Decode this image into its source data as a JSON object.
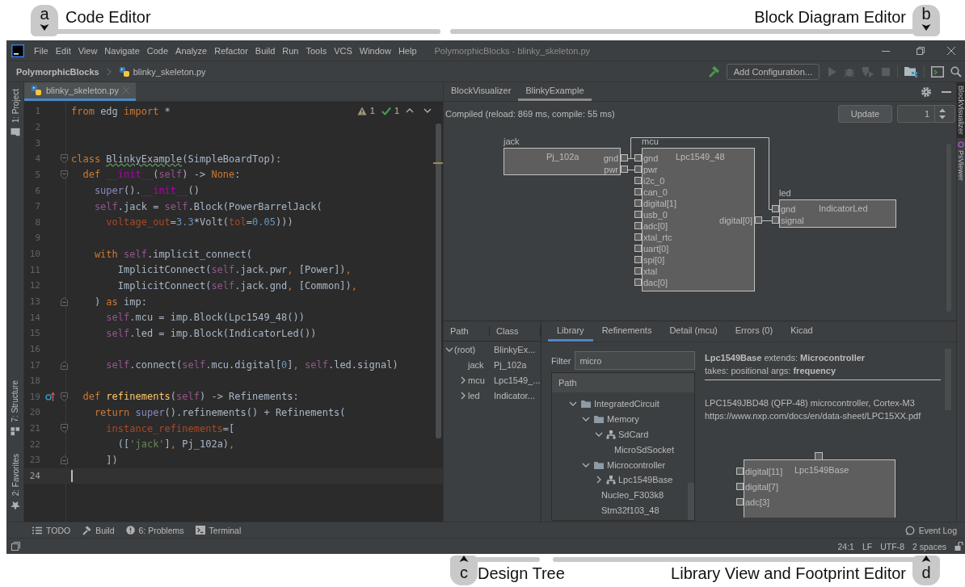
{
  "annotations_top": [
    {
      "letter": "a",
      "label": "Code Editor"
    },
    {
      "letter": "b",
      "label": "Block Diagram Editor"
    }
  ],
  "window": {
    "menu": [
      "File",
      "Edit",
      "View",
      "Navigate",
      "Code",
      "Analyze",
      "Refactor",
      "Build",
      "Run",
      "Tools",
      "VCS",
      "Window",
      "Help"
    ],
    "title": "PolymorphicBlocks - blinky_skeleton.py"
  },
  "navigation_bar": {
    "project": "PolymorphicBlocks",
    "file": "blinky_skeleton.py",
    "run_configuration": "Add Configuration..."
  },
  "left_tool_strip": [
    {
      "label": "1: Project",
      "kind": "project"
    },
    {
      "label": "7: Structure",
      "kind": "structure"
    },
    {
      "label": "2: Favorites",
      "kind": "favorites"
    }
  ],
  "editor": {
    "tabs": [
      {
        "label": "blinky_skeleton.py",
        "selected": true
      }
    ],
    "inspections": {
      "warnings": "1",
      "passed": "1"
    },
    "lines": [
      {
        "number": "1",
        "kind": "line",
        "caret": false,
        "tokens": [
          {
            "kind": "keyword",
            "text": "from"
          },
          {
            "kind": "plain",
            "text": " edg "
          },
          {
            "kind": "keyword",
            "text": "import"
          },
          {
            "kind": "plain",
            "text": " *"
          }
        ]
      },
      {
        "number": "2",
        "kind": "line",
        "caret": false
      },
      {
        "number": "3",
        "kind": "line",
        "caret": false
      },
      {
        "number": "4",
        "kind": "fold-start",
        "caret": false,
        "tokens": [
          {
            "kind": "keyword",
            "text": "class "
          },
          {
            "kind": "typo",
            "text": "BlinkyExample"
          },
          {
            "kind": "plain",
            "text": "(SimpleBoardTop):"
          }
        ]
      },
      {
        "number": "5",
        "kind": "fold-start",
        "caret": false,
        "tokens": [
          {
            "kind": "keyword",
            "text": "  def "
          },
          {
            "kind": "magic",
            "text": "__init__"
          },
          {
            "kind": "plain",
            "text": "("
          },
          {
            "kind": "self",
            "text": "self"
          },
          {
            "kind": "plain",
            "text": ") -> "
          },
          {
            "kind": "keyword",
            "text": "None"
          },
          {
            "kind": "plain",
            "text": ":"
          }
        ]
      },
      {
        "number": "6",
        "kind": "line",
        "caret": false,
        "tokens": [
          {
            "kind": "builtin",
            "text": "    super"
          },
          {
            "kind": "plain",
            "text": "()."
          },
          {
            "kind": "magic",
            "text": "__init__"
          },
          {
            "kind": "plain",
            "text": "()"
          }
        ]
      },
      {
        "number": "7",
        "kind": "line",
        "caret": false,
        "tokens": [
          {
            "kind": "self",
            "text": "    self"
          },
          {
            "kind": "plain",
            "text": ".jack = "
          },
          {
            "kind": "self",
            "text": "self"
          },
          {
            "kind": "plain",
            "text": ".Block(PowerBarrelJack("
          }
        ]
      },
      {
        "number": "8",
        "kind": "line",
        "caret": false,
        "tokens": [
          {
            "kind": "param",
            "text": "      voltage_out"
          },
          {
            "kind": "plain",
            "text": "="
          },
          {
            "kind": "number",
            "text": "3.3"
          },
          {
            "kind": "plain",
            "text": "*Volt("
          },
          {
            "kind": "param",
            "text": "tol"
          },
          {
            "kind": "plain",
            "text": "="
          },
          {
            "kind": "number",
            "text": "0.05"
          },
          {
            "kind": "plain",
            "text": ")))"
          }
        ]
      },
      {
        "number": "9",
        "kind": "line",
        "caret": false
      },
      {
        "number": "10",
        "kind": "line",
        "caret": false,
        "tokens": [
          {
            "kind": "keyword",
            "text": "    with "
          },
          {
            "kind": "self",
            "text": "self"
          },
          {
            "kind": "plain",
            "text": ".implicit_connect("
          }
        ]
      },
      {
        "number": "11",
        "kind": "line",
        "caret": false,
        "tokens": [
          {
            "kind": "plain",
            "text": "        ImplicitConnect("
          },
          {
            "kind": "self",
            "text": "self"
          },
          {
            "kind": "plain",
            "text": ".jack.pwr"
          },
          {
            "kind": "keyword",
            "text": ", "
          },
          {
            "kind": "plain",
            "text": "[Power])"
          },
          {
            "kind": "keyword",
            "text": ","
          }
        ]
      },
      {
        "number": "12",
        "kind": "line",
        "caret": false,
        "tokens": [
          {
            "kind": "plain",
            "text": "        ImplicitConnect("
          },
          {
            "kind": "self",
            "text": "self"
          },
          {
            "kind": "plain",
            "text": ".jack.gnd"
          },
          {
            "kind": "keyword",
            "text": ", "
          },
          {
            "kind": "plain",
            "text": "[Common])"
          },
          {
            "kind": "keyword",
            "text": ","
          }
        ]
      },
      {
        "number": "13",
        "kind": "fold-end",
        "caret": false,
        "tokens": [
          {
            "kind": "plain",
            "text": "    ) "
          },
          {
            "kind": "keyword",
            "text": "as"
          },
          {
            "kind": "plain",
            "text": " imp:"
          }
        ]
      },
      {
        "number": "14",
        "kind": "line",
        "caret": false,
        "tokens": [
          {
            "kind": "self",
            "text": "      self"
          },
          {
            "kind": "plain",
            "text": ".mcu = imp.Block(Lpc1549_48())"
          }
        ]
      },
      {
        "number": "15",
        "kind": "line",
        "caret": false,
        "tokens": [
          {
            "kind": "self",
            "text": "      self"
          },
          {
            "kind": "plain",
            "text": ".led = imp.Block(IndicatorLed())"
          }
        ]
      },
      {
        "number": "16",
        "kind": "line",
        "caret": false
      },
      {
        "number": "17",
        "kind": "fold-end",
        "caret": false,
        "tokens": [
          {
            "kind": "self",
            "text": "      self"
          },
          {
            "kind": "plain",
            "text": ".connect("
          },
          {
            "kind": "self",
            "text": "self"
          },
          {
            "kind": "plain",
            "text": ".mcu.digital["
          },
          {
            "kind": "number",
            "text": "0"
          },
          {
            "kind": "plain",
            "text": "]"
          },
          {
            "kind": "keyword",
            "text": ", "
          },
          {
            "kind": "self",
            "text": "self"
          },
          {
            "kind": "plain",
            "text": ".led.signal)"
          }
        ]
      },
      {
        "number": "18",
        "kind": "line",
        "caret": false
      },
      {
        "number": "19",
        "kind": "override",
        "caret": false,
        "tokens": [
          {
            "kind": "keyword",
            "text": "  def "
          },
          {
            "kind": "function",
            "text": "refinements"
          },
          {
            "kind": "plain",
            "text": "("
          },
          {
            "kind": "self",
            "text": "self"
          },
          {
            "kind": "plain",
            "text": ") -> Refinements:"
          }
        ]
      },
      {
        "number": "20",
        "kind": "line",
        "caret": false,
        "tokens": [
          {
            "kind": "keyword",
            "text": "    return "
          },
          {
            "kind": "builtin",
            "text": "super"
          },
          {
            "kind": "plain",
            "text": "().refinements() + Refinements("
          }
        ]
      },
      {
        "number": "21",
        "kind": "fold-start",
        "caret": false,
        "tokens": [
          {
            "kind": "param",
            "text": "      instance_refinements"
          },
          {
            "kind": "plain",
            "text": "=["
          }
        ]
      },
      {
        "number": "22",
        "kind": "line",
        "caret": false,
        "tokens": [
          {
            "kind": "plain",
            "text": "        (["
          },
          {
            "kind": "string",
            "text": "'jack'"
          },
          {
            "kind": "plain",
            "text": "]"
          },
          {
            "kind": "keyword",
            "text": ", "
          },
          {
            "kind": "plain",
            "text": "Pj_102a)"
          },
          {
            "kind": "keyword",
            "text": ","
          }
        ]
      },
      {
        "number": "23",
        "kind": "fold-end",
        "caret": false,
        "tokens": [
          {
            "kind": "plain",
            "text": "      ])"
          }
        ]
      },
      {
        "number": "24",
        "kind": "line",
        "caret": true
      }
    ]
  },
  "visualizer": {
    "tabs": [
      {
        "label": "BlockVisualizer",
        "selected": false
      },
      {
        "label": "BlinkyExample",
        "selected": true
      }
    ],
    "status": "Compiled (reload: 869 ms, compile: 55 ms)",
    "update_button": "Update",
    "depth": "1",
    "blocks": [
      {
        "name": "jack",
        "type": "Pj_102a",
        "ports_right": [
          "gnd",
          "pwr"
        ]
      },
      {
        "name": "mcu",
        "type": "Lpc1549_48",
        "ports_left": [
          "gnd",
          "pwr",
          "i2c_0",
          "can_0",
          "digital[1]",
          "usb_0",
          "adc[0]",
          "xtal_rtc",
          "uart[0]",
          "spi[0]",
          "xtal",
          "dac[0]"
        ],
        "ports_right": [
          "digital[0]"
        ]
      },
      {
        "name": "led",
        "type": "IndicatorLed",
        "ports_left": [
          "gnd",
          "signal"
        ]
      }
    ]
  },
  "side_strip": [
    {
      "label": "BlockVisualizer",
      "selected": true
    },
    {
      "label": "PsViewer",
      "selected": false
    }
  ],
  "design_tree": {
    "columns": [
      "Path",
      "Class"
    ],
    "rows": [
      {
        "path": "(root)",
        "class": "BlinkyEx...",
        "expanded": true,
        "children": [
          {
            "path": "jack",
            "class": "Pj_102a"
          },
          {
            "path": "mcu",
            "class": "Lpc1549_...",
            "expanded": false
          },
          {
            "path": "led",
            "class": "Indicator...",
            "expanded": false
          }
        ]
      }
    ]
  },
  "library": {
    "tabs": [
      {
        "label": "Library",
        "selected": true
      },
      {
        "label": "Refinements",
        "selected": false
      },
      {
        "label": "Detail (mcu)",
        "selected": false
      },
      {
        "label": "Errors (0)",
        "selected": false
      },
      {
        "label": "Kicad",
        "selected": false
      }
    ],
    "filter_label": "Filter",
    "filter_value": "micro",
    "tree_header": "Path",
    "tree": [
      {
        "label": "IntegratedCircuit",
        "kind": "folder",
        "expanded": true,
        "children": [
          {
            "label": "Memory",
            "kind": "folder",
            "expanded": true,
            "children": [
              {
                "label": "SdCard",
                "kind": "block",
                "expanded": true,
                "children": [
                  {
                    "label": "MicroSdSocket",
                    "kind": "leaf"
                  }
                ]
              }
            ]
          },
          {
            "label": "Microcontroller",
            "kind": "folder",
            "expanded": true,
            "children": [
              {
                "label": "Lpc1549Base",
                "kind": "block",
                "expanded": false
              },
              {
                "label": "Nucleo_F303k8",
                "kind": "leaf"
              },
              {
                "label": "Stm32f103_48",
                "kind": "leaf"
              }
            ]
          }
        ]
      }
    ],
    "detail": {
      "signature": "**Lpc1549Base** extends: **Microcontroller**",
      "args": "takes: positional args: **frequency**",
      "description": "LPC1549JBD48 (QFP-48) microcontroller, Cortex-M3",
      "link": "https://www.nxp.com/docs/en/data-sheet/LPC15XX.pdf"
    },
    "footprint": {
      "type": "Lpc1549Base",
      "ports_left": [
        "digital[11]",
        "digital[7]",
        "adc[3]"
      ]
    }
  },
  "tool_windows": [
    {
      "label": "TODO",
      "kind": "todo"
    },
    {
      "label": "Build",
      "kind": "build"
    },
    {
      "label": "6: Problems",
      "kind": "problems"
    },
    {
      "label": "Terminal",
      "kind": "terminal"
    }
  ],
  "event_log": "Event Log",
  "status_bar": [
    "24:1",
    "LF",
    "UTF-8",
    "2 spaces"
  ],
  "annotations_bottom": [
    {
      "letter": "c",
      "label": "Design Tree"
    },
    {
      "letter": "d",
      "label": "Library View and Footprint Editor"
    }
  ]
}
